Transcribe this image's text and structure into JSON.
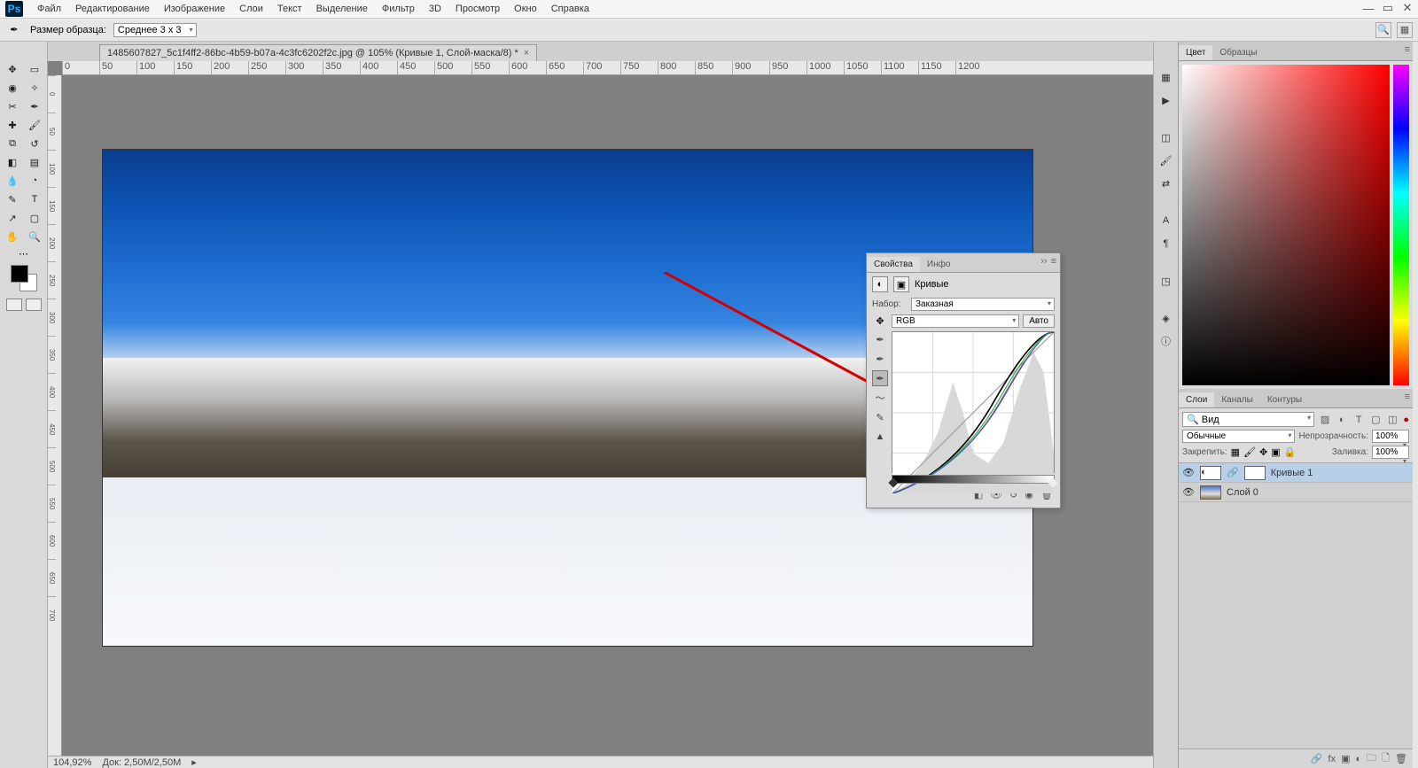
{
  "menu": {
    "items": [
      "Файл",
      "Редактирование",
      "Изображение",
      "Слои",
      "Текст",
      "Выделение",
      "Фильтр",
      "3D",
      "Просмотр",
      "Окно",
      "Справка"
    ]
  },
  "options": {
    "label_sample": "Размер образца:",
    "sample_value": "Среднее 3 x 3"
  },
  "doc_tab": {
    "title": "1485607827_5c1f4ff2-86bc-4b59-b07a-4c3fc6202f2c.jpg @ 105% (Кривые 1, Слой-маска/8) *"
  },
  "ruler_h": [
    "0",
    "50",
    "100",
    "150",
    "200",
    "250",
    "300",
    "350",
    "400",
    "450",
    "500",
    "550",
    "600",
    "650",
    "700",
    "750",
    "800",
    "850",
    "900",
    "950",
    "1000",
    "1050",
    "1100",
    "1150",
    "1200"
  ],
  "ruler_v": [
    "0",
    "50",
    "100",
    "150",
    "200",
    "250",
    "300",
    "350",
    "400",
    "450",
    "500",
    "550",
    "600",
    "650",
    "700"
  ],
  "status": {
    "zoom": "104,92%",
    "docsize": "Док: 2,50M/2,50M"
  },
  "color_panel": {
    "tabs": [
      "Цвет",
      "Образцы"
    ]
  },
  "layers_panel": {
    "tabs": [
      "Слои",
      "Каналы",
      "Контуры"
    ],
    "kind_label": "Вид",
    "blend": "Обычные",
    "opacity_label": "Непрозрачность:",
    "opacity_value": "100%",
    "lock_label": "Закрепить:",
    "fill_label": "Заливка:",
    "fill_value": "100%",
    "layers": [
      {
        "name": "Кривые 1",
        "selected": true,
        "hasMask": true
      },
      {
        "name": "Слой 0",
        "selected": false,
        "hasMask": false
      }
    ]
  },
  "props": {
    "tabs": [
      "Свойства",
      "Инфо"
    ],
    "title": "Кривые",
    "preset_label": "Набор:",
    "preset_value": "Заказная",
    "channel_value": "RGB",
    "auto_btn": "Авто"
  }
}
